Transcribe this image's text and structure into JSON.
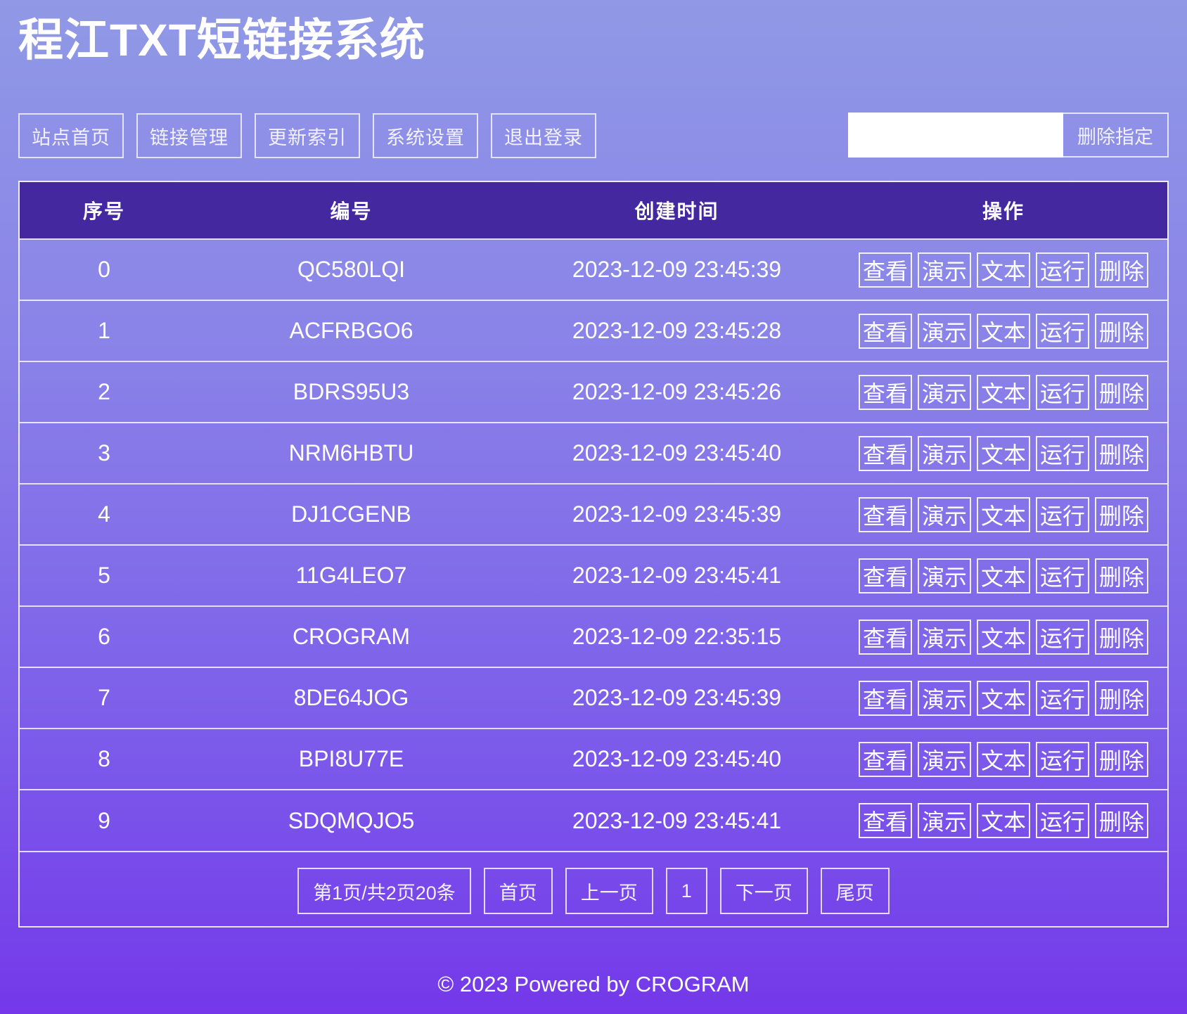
{
  "title": "程江TXT短链接系统",
  "nav": [
    "站点首页",
    "链接管理",
    "更新索引",
    "系统设置",
    "退出登录"
  ],
  "search": {
    "value": "",
    "button_label": "删除指定"
  },
  "table": {
    "headers": [
      "序号",
      "编号",
      "创建时间",
      "操作"
    ],
    "action_labels": [
      "查看",
      "演示",
      "文本",
      "运行",
      "删除"
    ],
    "rows": [
      {
        "index": "0",
        "code": "QC580LQI",
        "created": "2023-12-09 23:45:39"
      },
      {
        "index": "1",
        "code": "ACFRBGO6",
        "created": "2023-12-09 23:45:28"
      },
      {
        "index": "2",
        "code": "BDRS95U3",
        "created": "2023-12-09 23:45:26"
      },
      {
        "index": "3",
        "code": "NRM6HBTU",
        "created": "2023-12-09 23:45:40"
      },
      {
        "index": "4",
        "code": "DJ1CGENB",
        "created": "2023-12-09 23:45:39"
      },
      {
        "index": "5",
        "code": "11G4LEO7",
        "created": "2023-12-09 23:45:41"
      },
      {
        "index": "6",
        "code": "CROGRAM",
        "created": "2023-12-09 22:35:15"
      },
      {
        "index": "7",
        "code": "8DE64JOG",
        "created": "2023-12-09 23:45:39"
      },
      {
        "index": "8",
        "code": "BPI8U77E",
        "created": "2023-12-09 23:45:40"
      },
      {
        "index": "9",
        "code": "SDQMQJO5",
        "created": "2023-12-09 23:45:41"
      }
    ]
  },
  "pagination": {
    "info": "第1页/共2页20条",
    "first": "首页",
    "prev": "上一页",
    "current": "1",
    "next": "下一页",
    "last": "尾页"
  },
  "footer": "© 2023 Powered by CROGRAM"
}
